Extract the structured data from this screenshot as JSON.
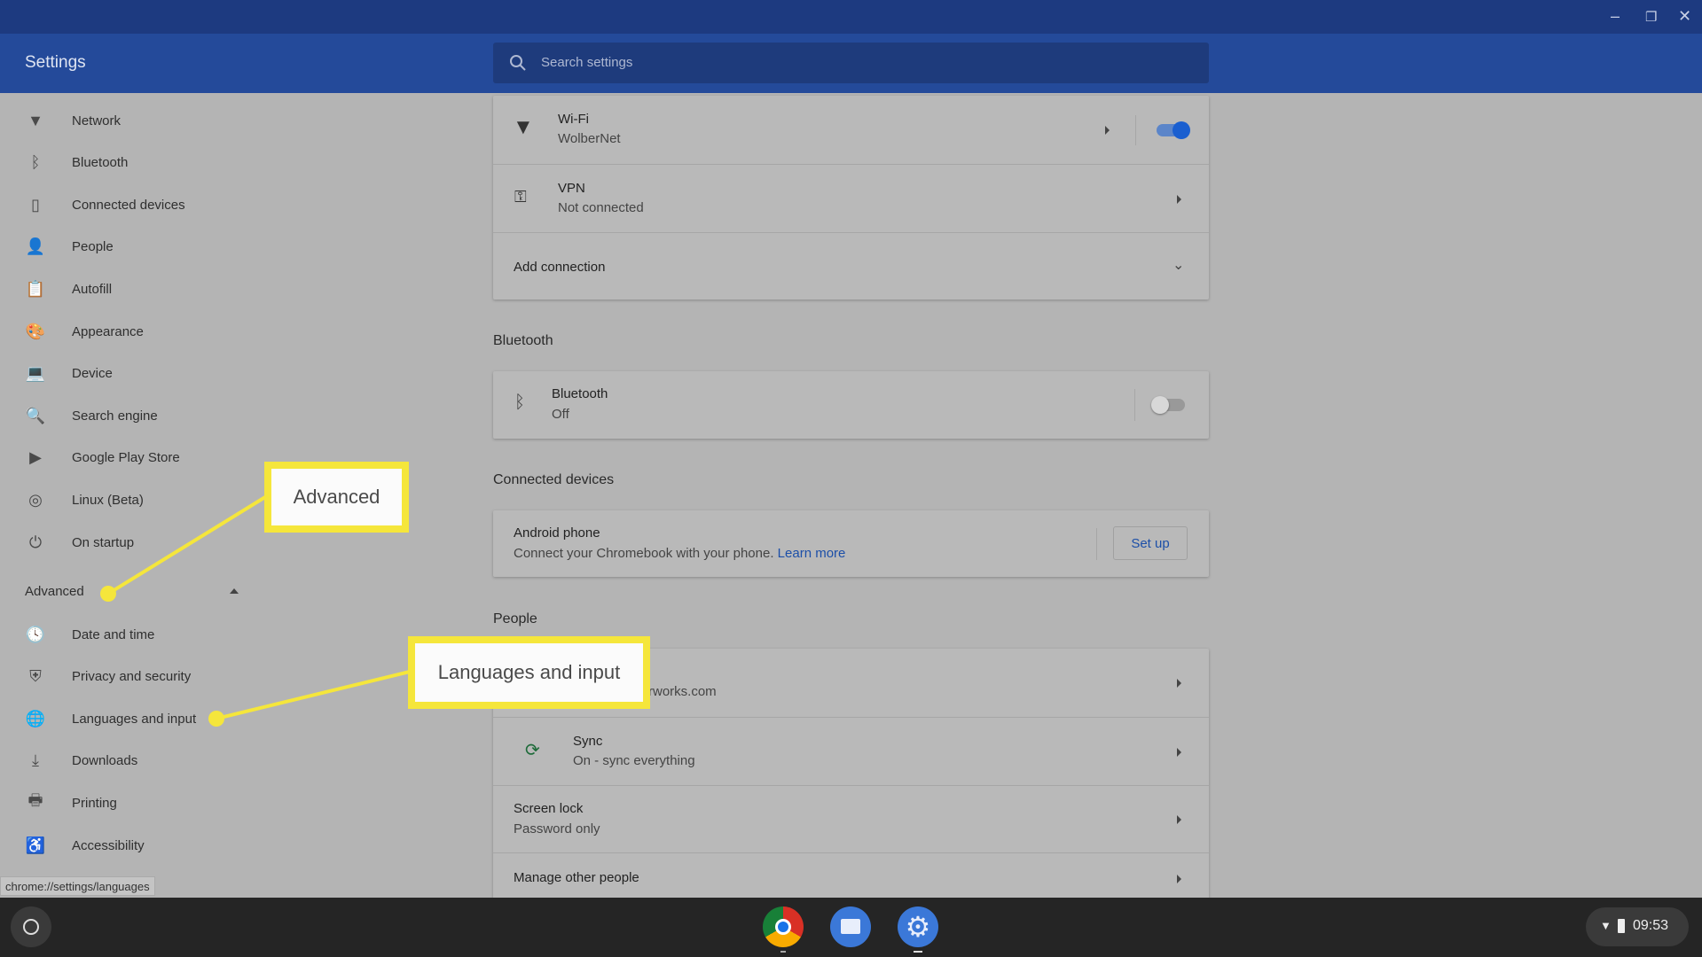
{
  "window": {
    "controls": [
      "minimize",
      "restore",
      "close"
    ]
  },
  "header": {
    "title": "Settings",
    "search_placeholder": "Search settings"
  },
  "sidebar": {
    "items": [
      {
        "label": "Network",
        "icon": "wifi-icon",
        "glyph": "▼"
      },
      {
        "label": "Bluetooth",
        "icon": "bluetooth-icon",
        "glyph": "ᛒ"
      },
      {
        "label": "Connected devices",
        "icon": "phone-icon",
        "glyph": "▯"
      },
      {
        "label": "People",
        "icon": "person-icon",
        "glyph": "👤"
      },
      {
        "label": "Autofill",
        "icon": "clipboard-icon",
        "glyph": "📋"
      },
      {
        "label": "Appearance",
        "icon": "palette-icon",
        "glyph": "🎨"
      },
      {
        "label": "Device",
        "icon": "laptop-icon",
        "glyph": "💻"
      },
      {
        "label": "Search engine",
        "icon": "search-icon",
        "glyph": "🔍"
      },
      {
        "label": "Google Play Store",
        "icon": "play-store-icon",
        "glyph": "▶"
      },
      {
        "label": "Linux (Beta)",
        "icon": "linux-icon",
        "glyph": "◎"
      },
      {
        "label": "On startup",
        "icon": "power-icon",
        "glyph": "⏻"
      }
    ],
    "advanced_label": "Advanced",
    "advanced_items": [
      {
        "label": "Date and time",
        "icon": "clock-icon",
        "glyph": "🕓"
      },
      {
        "label": "Privacy and security",
        "icon": "shield-icon",
        "glyph": "⛨"
      },
      {
        "label": "Languages and input",
        "icon": "globe-icon",
        "glyph": "🌐"
      },
      {
        "label": "Downloads",
        "icon": "download-icon",
        "glyph": "⤓"
      },
      {
        "label": "Printing",
        "icon": "printer-icon",
        "glyph": "🖶"
      },
      {
        "label": "Accessibility",
        "icon": "accessibility-icon",
        "glyph": "♿"
      }
    ]
  },
  "status_url": "chrome://settings/languages",
  "network": {
    "wifi": {
      "title": "Wi-Fi",
      "subtitle": "WolberNet",
      "enabled": true
    },
    "vpn": {
      "title": "VPN",
      "subtitle": "Not connected"
    },
    "add": "Add connection"
  },
  "bluetooth": {
    "heading": "Bluetooth",
    "title": "Bluetooth",
    "subtitle": "Off",
    "enabled": false
  },
  "connected": {
    "heading": "Connected devices",
    "title": "Android phone",
    "subtitle": "Connect your Chromebook with your phone.",
    "link": "Learn more",
    "button": "Set up"
  },
  "people": {
    "heading": "People",
    "account_sub": "rworks.com",
    "sync": {
      "title": "Sync",
      "subtitle": "On - sync everything"
    },
    "screen_lock": {
      "title": "Screen lock",
      "subtitle": "Password only"
    },
    "manage": "Manage other people"
  },
  "callouts": {
    "advanced": "Advanced",
    "languages": "Languages and input"
  },
  "tray": {
    "time": "09:53"
  },
  "colors": {
    "accent": "#1a73e8",
    "highlight": "#f5e63b",
    "header": "#244a9a"
  }
}
